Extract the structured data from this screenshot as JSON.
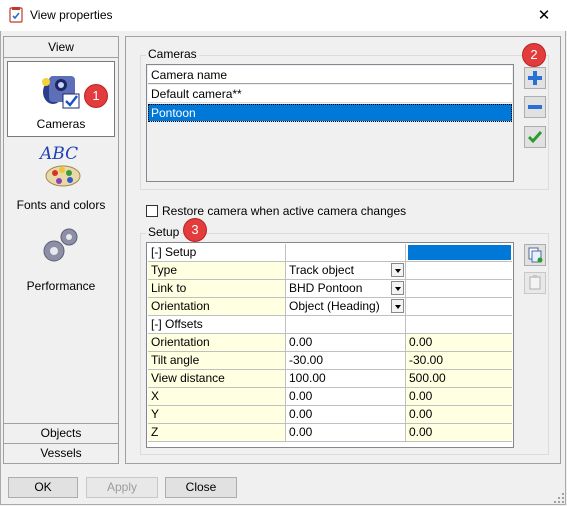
{
  "window": {
    "title": "View properties"
  },
  "sidebar": {
    "header": "View",
    "items": [
      {
        "label": "Cameras",
        "icon": "camera-icon",
        "selected": true
      },
      {
        "label": "Fonts and colors",
        "icon": "abc-palette-icon",
        "selected": false
      },
      {
        "label": "Performance",
        "icon": "gears-icon",
        "selected": false
      }
    ],
    "bottom_tabs": [
      "Objects",
      "Vessels"
    ]
  },
  "cameras": {
    "group_title": "Cameras",
    "column_header": "Camera name",
    "rows": [
      "Default camera**",
      "Pontoon"
    ],
    "selected_index": 1
  },
  "restore_checkbox": {
    "label": "Restore camera when active camera changes",
    "checked": false
  },
  "setup": {
    "group_title": "Setup",
    "rows": [
      {
        "c1": "[-] Setup",
        "c2": "",
        "c3": "",
        "style": "section"
      },
      {
        "c1": "Type",
        "c2": "Track object",
        "c3": "",
        "combo": true
      },
      {
        "c1": "Link to",
        "c2": "BHD Pontoon",
        "c3": "",
        "combo": true
      },
      {
        "c1": "Orientation",
        "c2": "Object (Heading)",
        "c3": "",
        "combo": true
      },
      {
        "c1": "[-] Offsets",
        "c2": "",
        "c3": "",
        "style": "section"
      },
      {
        "c1": "Orientation",
        "c2": "0.00",
        "c3": "0.00"
      },
      {
        "c1": "Tilt angle",
        "c2": "-30.00",
        "c3": "-30.00"
      },
      {
        "c1": "View distance",
        "c2": "100.00",
        "c3": "500.00"
      },
      {
        "c1": "X",
        "c2": "0.00",
        "c3": "0.00"
      },
      {
        "c1": "Y",
        "c2": "0.00",
        "c3": "0.00"
      },
      {
        "c1": "Z",
        "c2": "0.00",
        "c3": "0.00"
      }
    ]
  },
  "buttons": {
    "ok": "OK",
    "apply": "Apply",
    "cancel": "Close"
  },
  "annotations": [
    "1",
    "2",
    "3"
  ],
  "colors": {
    "selection": "#0078d7",
    "badge": "#e23c3c",
    "yellow_cell": "#ffffe1"
  }
}
